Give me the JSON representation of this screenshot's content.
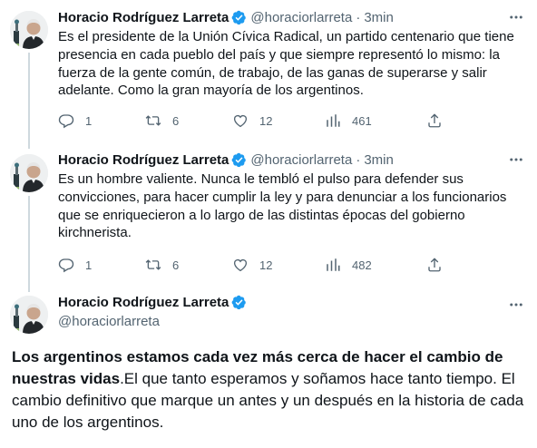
{
  "tweets": [
    {
      "author_name": "Horacio Rodríguez Larreta",
      "handle": "@horaciorlarreta",
      "separator": "·",
      "time": "3min",
      "text": "Es el presidente de la Unión Cívica Radical, un partido centenario que tiene presencia en cada pueblo del país y que siempre representó lo mismo: la fuerza de la gente común, de trabajo, de las ganas de superarse y salir adelante. Como la gran mayoría de los argentinos.",
      "replies": "1",
      "retweets": "6",
      "likes": "12",
      "views": "461"
    },
    {
      "author_name": "Horacio Rodríguez Larreta",
      "handle": "@horaciorlarreta",
      "separator": "·",
      "time": "3min",
      "text": "Es un hombre valiente. Nunca le tembló el pulso para defender sus convicciones, para hacer cumplir la ley y para denunciar a los funcionarios que se enriquecieron a lo largo de las distintas épocas del gobierno kirchnerista.",
      "replies": "1",
      "retweets": "6",
      "likes": "12",
      "views": "482"
    }
  ],
  "main_tweet": {
    "author_name": "Horacio Rodríguez Larreta",
    "handle": "@horaciorlarreta",
    "text_bold": "Los argentinos estamos cada vez más cerca de hacer el cambio de nuestras vidas",
    "text_rest": ".El que tanto esperamos y soñamos hace tanto tiempo. El cambio definitivo que marque un antes y un después en la historia de cada uno de los argentinos."
  },
  "icons": {
    "verified": "verified-badge-icon",
    "more": "more-options-icon",
    "reply": "reply-icon",
    "retweet": "retweet-icon",
    "like": "heart-icon",
    "views": "views-icon",
    "share": "share-icon"
  },
  "colors": {
    "text": "#0f1419",
    "secondary": "#536471",
    "verified_blue": "#1d9bf0",
    "thread_line": "#cfd9de"
  }
}
